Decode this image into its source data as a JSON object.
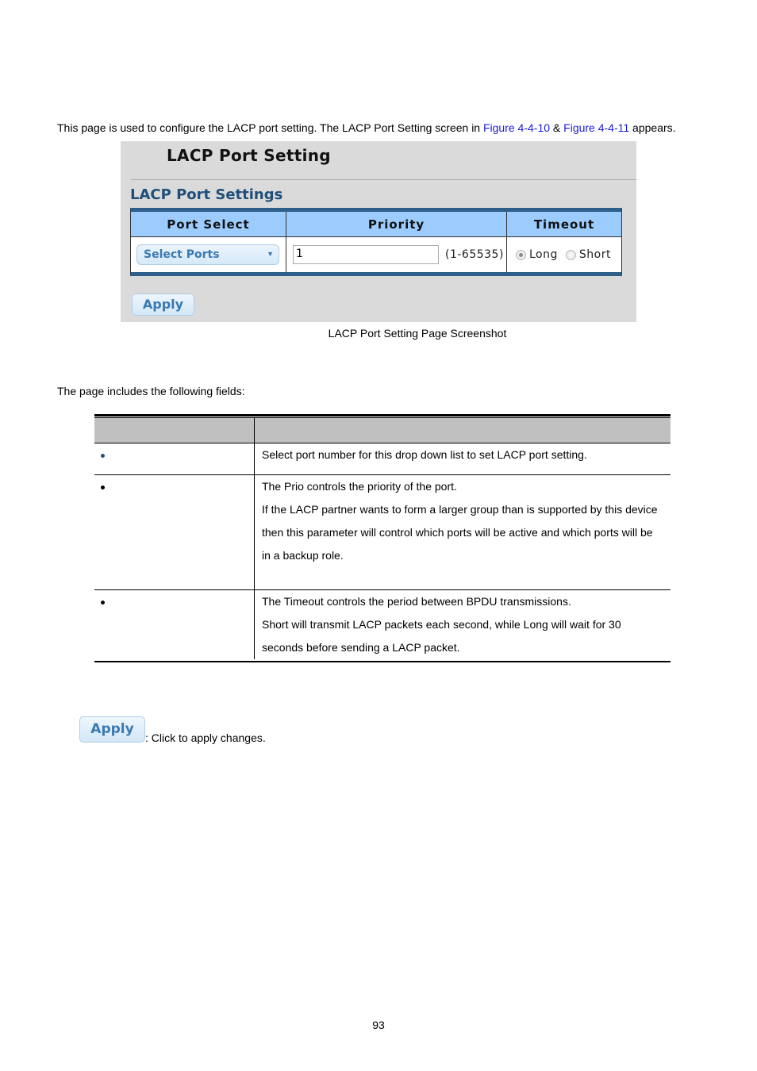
{
  "intro": {
    "text_before": "This page is used to configure the LACP port setting. The LACP Port Setting screen in ",
    "link1": "Figure 4-4-10",
    "between": " & ",
    "link2": "Figure 4-4-11",
    "text_after": " appears."
  },
  "screenshot": {
    "title": "LACP Port Setting",
    "section_title": "LACP Port Settings",
    "columns": [
      "Port Select",
      "Priority",
      "Timeout"
    ],
    "port_select": {
      "value": "Select Ports"
    },
    "priority": {
      "value": "1",
      "range": "(1-65535)"
    },
    "timeout": {
      "options": [
        "Long",
        "Short"
      ],
      "selected": "Long"
    },
    "apply_label": "Apply"
  },
  "caption": "LACP Port Setting Page Screenshot",
  "fields_intro": "The page includes the following fields:",
  "fields_table": {
    "headers": [
      "",
      ""
    ],
    "rows": [
      {
        "object": "",
        "description": [
          "Select port number for this drop down list to set LACP port setting."
        ]
      },
      {
        "object": "",
        "description": [
          "The Prio controls the priority of the port.",
          "If the LACP partner wants to form a larger group than is supported by this device",
          "then this parameter will control which ports will be active and which ports will be",
          "in a backup role."
        ]
      },
      {
        "object": "",
        "description": [
          "The Timeout controls the period between BPDU transmissions.",
          "Short will transmit LACP packets each second, while Long will wait for 30",
          "seconds before sending a LACP packet."
        ]
      }
    ]
  },
  "buttons_help": {
    "apply_label": "Apply",
    "apply_desc": ": Click to apply changes."
  },
  "page_number": "93",
  "colors": {
    "link": "#1a1adb",
    "header_blue": "#9cccfd",
    "table_border_blue": "#2e5f8a",
    "section_title": "#1f4e79",
    "button_text": "#3a7ab0",
    "panel_bg": "#dadada",
    "desc_header_bg": "#c0c0c0"
  }
}
